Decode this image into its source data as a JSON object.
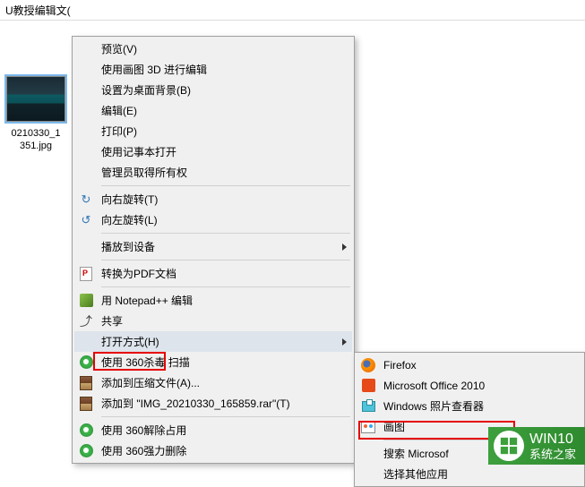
{
  "windowTitle": "U教授编辑文(",
  "thumbnail": {
    "label_line1": "0210330_1",
    "label_line2": "351.jpg"
  },
  "contextMenu": {
    "preview": "预览(V)",
    "edit3d": "使用画图 3D 进行编辑",
    "setDesktop": "设置为桌面背景(B)",
    "edit": "编辑(E)",
    "print": "打印(P)",
    "notepad": "使用记事本打开",
    "adminOwnership": "管理员取得所有权",
    "rotateR": "向右旋转(T)",
    "rotateL": "向左旋转(L)",
    "castDevice": "播放到设备",
    "convertPdf": "转换为PDF文档",
    "notepadpp": "用 Notepad++ 编辑",
    "share": "共享",
    "openWith": "打开方式(H)",
    "scan360": "使用 360杀毒 扫描",
    "addArchive": "添加到压缩文件(A)...",
    "addToRar": "添加到 \"IMG_20210330_165859.rar\"(T)",
    "unblock360": "使用 360解除占用",
    "forceDelete360": "使用 360强力删除"
  },
  "submenu": {
    "firefox": "Firefox",
    "office": "Microsoft Office 2010",
    "photoViewer": "Windows 照片查看器",
    "paint": "画图",
    "searchMs": "搜索 Microsof",
    "chooseOther": "选择其他应用"
  },
  "watermark": {
    "top": "WIN10",
    "bottom": "系统之家"
  }
}
